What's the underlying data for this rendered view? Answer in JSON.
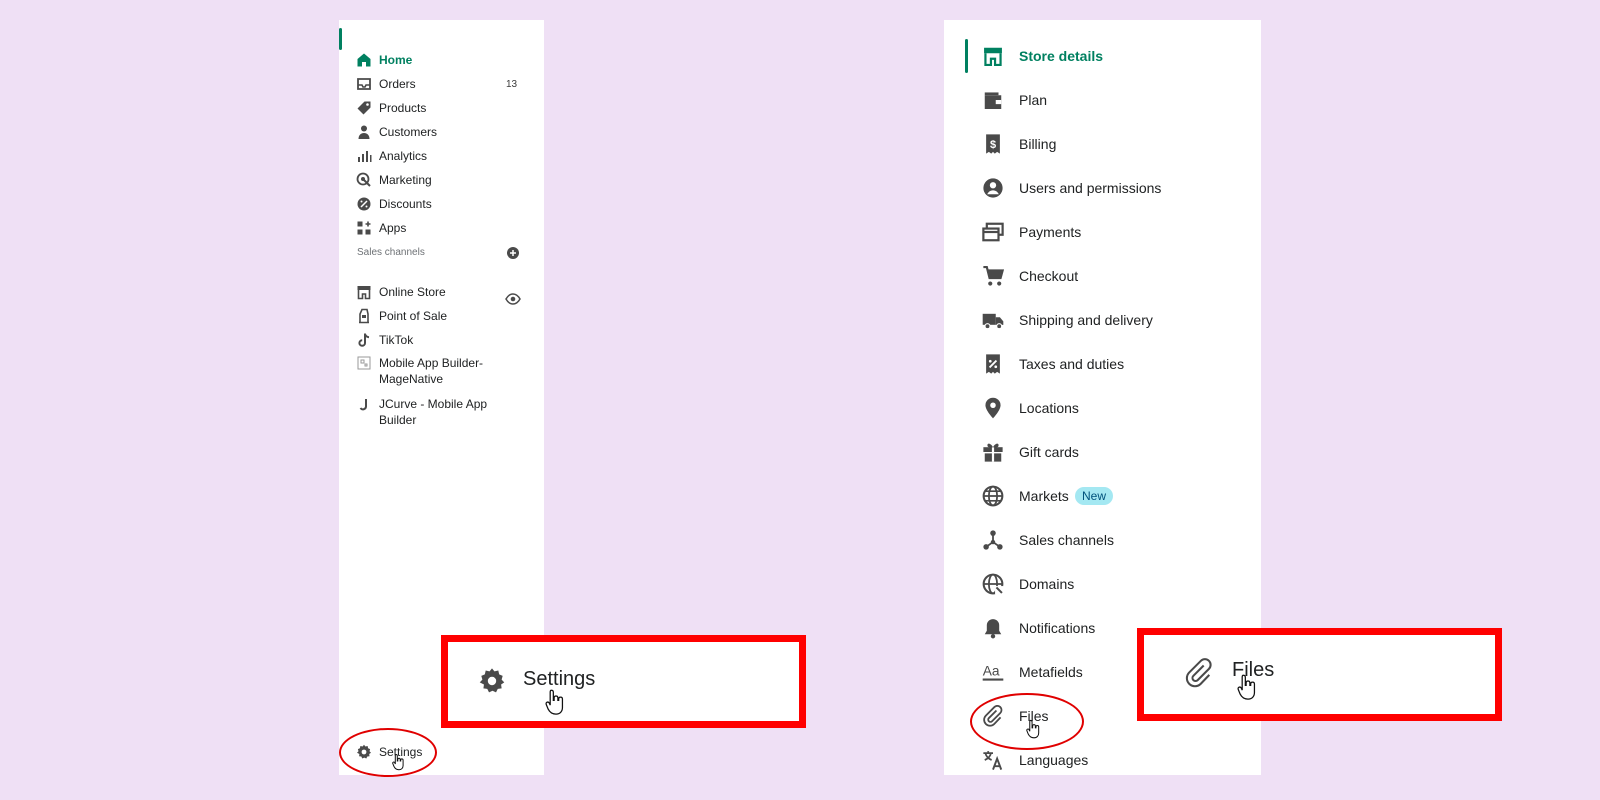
{
  "colors": {
    "background": "#efe0f5",
    "accent": "#008060",
    "highlight": "#ff0000",
    "new_badge_bg": "#a4e8f2"
  },
  "sidebar": {
    "items": [
      {
        "label": "Home",
        "icon": "home-icon",
        "active": true
      },
      {
        "label": "Orders",
        "icon": "inbox-icon",
        "count": "13"
      },
      {
        "label": "Products",
        "icon": "tag-icon"
      },
      {
        "label": "Customers",
        "icon": "person-icon"
      },
      {
        "label": "Analytics",
        "icon": "bar-chart-icon"
      },
      {
        "label": "Marketing",
        "icon": "target-icon"
      },
      {
        "label": "Discounts",
        "icon": "discount-icon"
      },
      {
        "label": "Apps",
        "icon": "apps-icon"
      }
    ],
    "sales_channels_heading": "Sales channels",
    "channels": [
      {
        "label": "Online Store",
        "icon": "store-icon"
      },
      {
        "label": "Point of Sale",
        "icon": "pos-icon"
      },
      {
        "label": "TikTok",
        "icon": "tiktok-icon"
      },
      {
        "label": "Mobile App Builder-MageNative",
        "icon": "app-builder-icon"
      },
      {
        "label": "JCurve - Mobile App Builder",
        "icon": "jcurve-icon"
      }
    ],
    "settings_label": "Settings"
  },
  "settings_callout": {
    "label": "Settings"
  },
  "settings_menu": {
    "items": [
      {
        "label": "Store details",
        "icon": "store-icon",
        "active": true
      },
      {
        "label": "Plan",
        "icon": "wallet-icon"
      },
      {
        "label": "Billing",
        "icon": "receipt-dollar-icon"
      },
      {
        "label": "Users and permissions",
        "icon": "user-circle-icon"
      },
      {
        "label": "Payments",
        "icon": "payment-icon"
      },
      {
        "label": "Checkout",
        "icon": "cart-icon"
      },
      {
        "label": "Shipping and delivery",
        "icon": "truck-icon"
      },
      {
        "label": "Taxes and duties",
        "icon": "tax-receipt-icon"
      },
      {
        "label": "Locations",
        "icon": "location-pin-icon"
      },
      {
        "label": "Gift cards",
        "icon": "gift-icon"
      },
      {
        "label": "Markets",
        "icon": "globe-icon",
        "badge": "New"
      },
      {
        "label": "Sales channels",
        "icon": "channels-icon"
      },
      {
        "label": "Domains",
        "icon": "domain-globe-icon"
      },
      {
        "label": "Notifications",
        "icon": "bell-icon"
      },
      {
        "label": "Metafields",
        "icon": "metafields-icon"
      },
      {
        "label": "Files",
        "icon": "paperclip-icon"
      },
      {
        "label": "Languages",
        "icon": "translate-icon"
      }
    ]
  },
  "files_callout": {
    "label": "Files"
  }
}
